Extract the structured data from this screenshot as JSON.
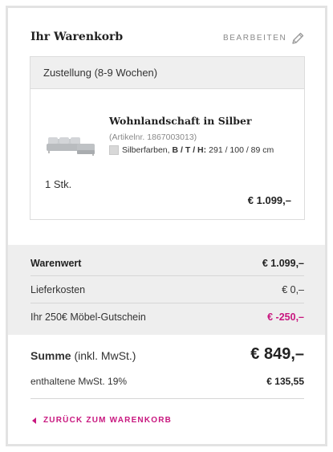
{
  "cart": {
    "title": "Ihr Warenkorb",
    "edit_label": "BEARBEITEN"
  },
  "delivery": {
    "header": "Zustellung (8-9 Wochen)",
    "item": {
      "name": "Wohnlandschaft in Silber",
      "article_number": "(Artikelnr. 1867003013)",
      "color": "Silberfarben,",
      "dims_label": "B / T / H:",
      "dims_value": "291 / 100 / 89 cm",
      "quantity": "1 Stk.",
      "price": "€ 1.099,–"
    }
  },
  "summary": {
    "rows": [
      {
        "label": "Warenwert",
        "value": "€ 1.099,–"
      },
      {
        "label": "Lieferkosten",
        "value": "€ 0,–"
      },
      {
        "label": "Ihr 250€ Möbel-Gutschein",
        "value": "€ -250,–"
      }
    ],
    "total_label": "Summe",
    "total_note": "(inkl. MwSt.)",
    "total_value": "€ 849,–",
    "vat_label": "enthaltene MwSt. 19%",
    "vat_value": "€ 135,55"
  },
  "back_link": "ZURÜCK ZUM WARENKORB",
  "colors": {
    "accent": "#c8177f",
    "panel_border": "#e3e3e3",
    "summary_bg": "#eeeeee"
  },
  "icons": {
    "edit": "pencil-icon",
    "back": "chevron-left-icon",
    "swatch": "color-swatch-icon"
  }
}
